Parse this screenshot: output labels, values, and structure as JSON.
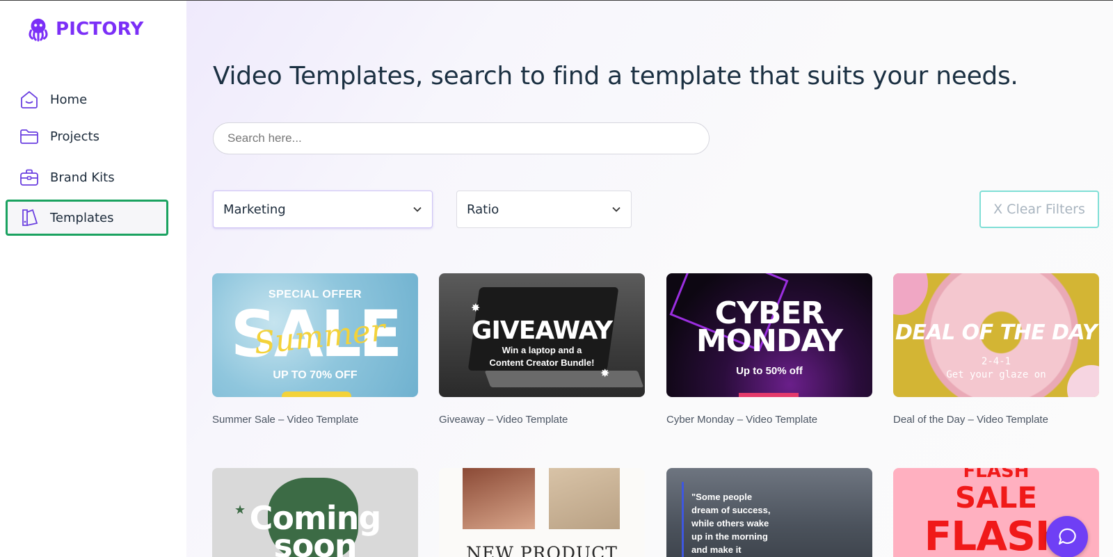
{
  "brand": {
    "name": "PICTORY",
    "color": "#7b2ff7"
  },
  "sidebar": {
    "items": [
      {
        "label": "Home",
        "icon": "home-icon",
        "active": false
      },
      {
        "label": "Projects",
        "icon": "folder-icon",
        "active": false
      },
      {
        "label": "Brand Kits",
        "icon": "briefcase-icon",
        "active": false
      },
      {
        "label": "Templates",
        "icon": "templates-icon",
        "active": true
      }
    ]
  },
  "main": {
    "title": "Video Templates, search to find a template that suits your needs.",
    "search": {
      "placeholder": "Search here...",
      "value": ""
    },
    "filters": {
      "category": {
        "value": "Marketing"
      },
      "ratio": {
        "value": "Ratio"
      },
      "clear_label": "X Clear Filters"
    },
    "templates": [
      {
        "title": "Summer Sale – Video Template",
        "thumb": {
          "top": "SPECIAL OFFER",
          "big": "SALE",
          "script": "Summer",
          "bottom": "UP TO 70% OFF"
        }
      },
      {
        "title": "Giveaway – Video Template",
        "thumb": {
          "big": "GIVEAWAY",
          "sub1": "Win a laptop and a",
          "sub2": "Content Creator Bundle!"
        }
      },
      {
        "title": "Cyber Monday – Video Template",
        "thumb": {
          "line1": "CYBER",
          "line2": "MONDAY",
          "sub": "Up to 50% off"
        }
      },
      {
        "title": "Deal of the Day – Video Template",
        "thumb": {
          "big": "DEAL OF THE DAY",
          "sub1": "2-4-1",
          "sub2": "Get your glaze on"
        }
      },
      {
        "thumb": {
          "line1": "Coming",
          "line2": "soon"
        }
      },
      {
        "thumb": {
          "big": "NEW PRODUCT"
        }
      },
      {
        "thumb": {
          "lines": [
            "\"Some people",
            "dream of success,",
            "while others wake",
            "up in the morning",
            "and make it"
          ]
        }
      },
      {
        "thumb": {
          "l1": "FLASH",
          "l2": "SALE",
          "l3": "FLASH"
        }
      }
    ]
  },
  "colors": {
    "active_nav_border": "#1aa260",
    "clear_border": "#7fdfd6",
    "chat": "#6f3ff5"
  }
}
